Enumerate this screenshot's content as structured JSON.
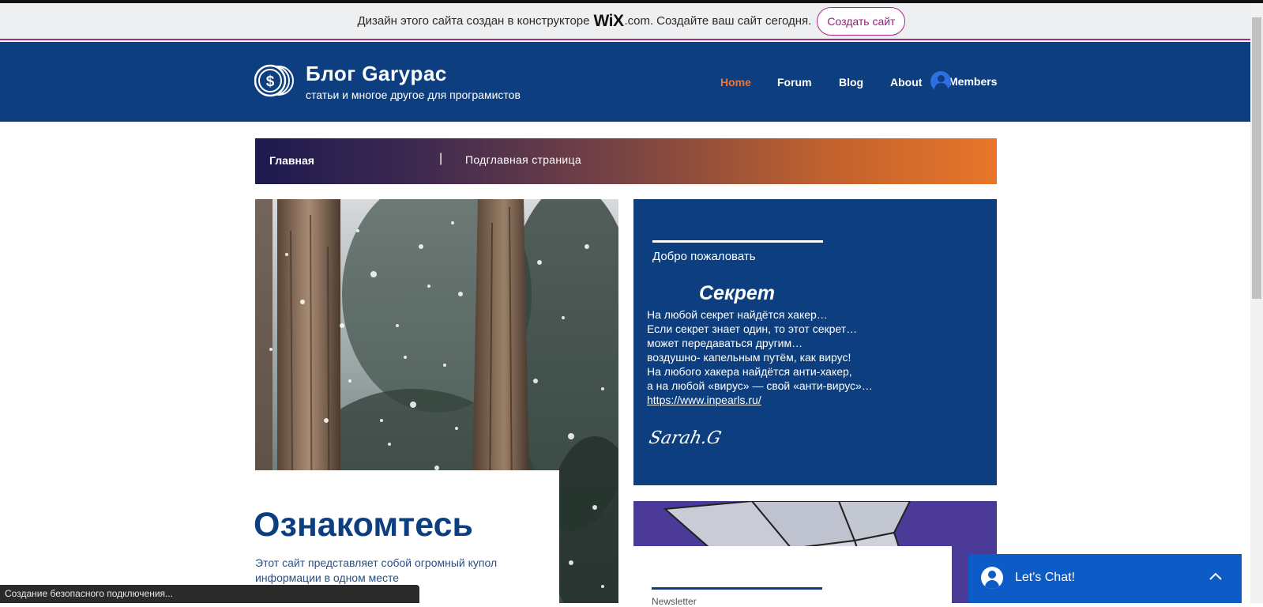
{
  "wix_bar": {
    "text_before": "Дизайн этого сайта создан в конструкторе",
    "wix_logo": "WiX",
    "dotcom": ".com.",
    "text_after": "Создайте ваш сайт сегодня.",
    "create_button": "Создать сайт"
  },
  "header": {
    "logo_icon": "dollar-coins-icon",
    "title": "Блог Garypac",
    "subtitle": "статьи и многое другое для програмистов",
    "nav": [
      {
        "label": "Home",
        "active": true
      },
      {
        "label": "Forum",
        "active": false
      },
      {
        "label": "Blog",
        "active": false
      },
      {
        "label": "About",
        "active": false
      }
    ],
    "members_label": "Members",
    "active_color": "#e8763a",
    "bg_color": "#0d3f80"
  },
  "banner": {
    "left": "Главная",
    "separator": "|",
    "right": "Подглавная страница"
  },
  "intro": {
    "title": "Ознакомтесь",
    "text": "Этот сайт представляет собой огромный купол информации в одном месте"
  },
  "card": {
    "welcome": "Добро пожаловать",
    "title": "Секрет",
    "lines": [
      "На любой секрет найдётся хакер…",
      "Если секрет знает один, то этот секрет…",
      "может передаваться другим…",
      "воздушно- капельным путём, как вирус!",
      "На любого хакера найдётся анти-хакер,",
      "а на любой «вирус» — свой «анти-вирус»…"
    ],
    "link": "https://www.inpearls.ru/",
    "signature": "Sarah.G"
  },
  "card2": {
    "newsletter": "Newsletter"
  },
  "chat": {
    "label": "Let's Chat!"
  },
  "status_bar": {
    "text": "Создание безопасного подключения..."
  }
}
